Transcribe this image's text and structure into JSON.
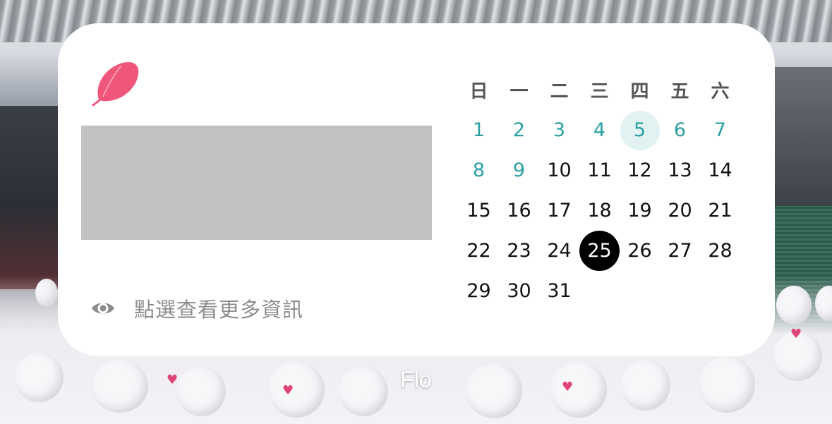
{
  "widget": {
    "info_text": "點選查看更多資訊",
    "logo_icon": "feather-icon",
    "eye_icon": "eye-icon",
    "accent_color": "#f0567a"
  },
  "calendar": {
    "weekdays": [
      "日",
      "一",
      "二",
      "三",
      "四",
      "五",
      "六"
    ],
    "days": [
      "1",
      "2",
      "3",
      "4",
      "5",
      "6",
      "7",
      "8",
      "9",
      "10",
      "11",
      "12",
      "13",
      "14",
      "15",
      "16",
      "17",
      "18",
      "19",
      "20",
      "21",
      "22",
      "23",
      "24",
      "25",
      "26",
      "27",
      "28",
      "29",
      "30",
      "31"
    ],
    "today": "25",
    "highlighted_day": "5",
    "past_color": "#2aa0a3",
    "today_color": "#000000"
  },
  "app_label": "Flo"
}
